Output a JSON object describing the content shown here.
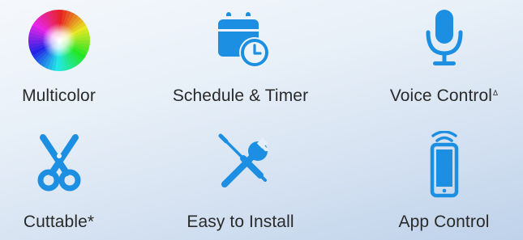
{
  "features": [
    {
      "label": "Multicolor",
      "icon": "color-wheel-icon"
    },
    {
      "label": "Schedule & Timer",
      "icon": "calendar-clock-icon"
    },
    {
      "label": "Voice Control",
      "mark": "Δ",
      "icon": "microphone-icon"
    },
    {
      "label": "Cuttable*",
      "icon": "scissors-icon"
    },
    {
      "label": "Easy to Install",
      "icon": "tools-icon"
    },
    {
      "label": "App Control",
      "icon": "smartphone-wireless-icon"
    }
  ],
  "colors": {
    "icon_blue": "#1d8fe2",
    "text": "#2a2a2a",
    "background_top": "#f5f8fc",
    "background_bottom": "#bed2ea"
  }
}
